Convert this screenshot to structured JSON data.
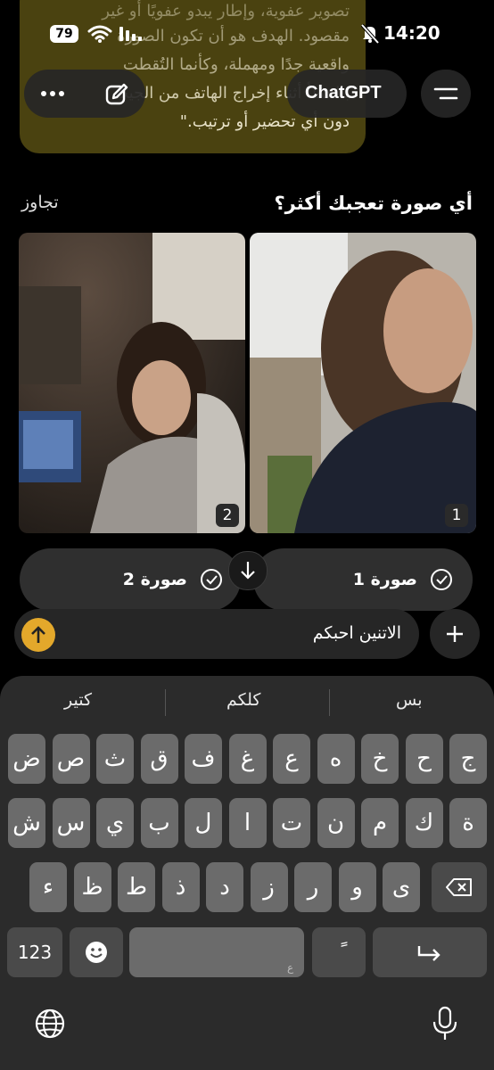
{
  "status_bar": {
    "battery": "79",
    "time": "14:20"
  },
  "bubble": {
    "lines": [
      "تصوير عفوية، وإطار يبدو عفويًا أو غير",
      "مقصود. الهدف هو أن تكون الصورة",
      "واقعية جدًا ومهملة، وكأنما التُقطت",
      "بالخطأ أثناء إخراج الهاتف من الجيب",
      "دون أي تحضير أو ترتيب.\""
    ]
  },
  "header": {
    "title": "ChatGPT"
  },
  "comparison": {
    "question": "أي صورة تعجبك أكثر؟",
    "skip_label": "تجاوز",
    "images": [
      {
        "number": "1"
      },
      {
        "number": "2"
      }
    ],
    "choices": [
      {
        "label": "صورة 1"
      },
      {
        "label": "صورة 2"
      }
    ]
  },
  "composer": {
    "text": "الاتنين احبكم"
  },
  "keyboard": {
    "suggestions": [
      "بس",
      "كلكم",
      "كتير"
    ],
    "row1": [
      "ج",
      "ح",
      "خ",
      "ه",
      "ع",
      "غ",
      "ف",
      "ق",
      "ث",
      "ص",
      "ض"
    ],
    "row2": [
      "ة",
      "ك",
      "م",
      "ن",
      "ت",
      "ا",
      "ل",
      "ب",
      "ي",
      "س",
      "ش"
    ],
    "row3": [
      "ى",
      "و",
      "ر",
      "ز",
      "د",
      "ذ",
      "ط",
      "ظ",
      "ء"
    ],
    "numbers_label": "123",
    "space_hint": "ع",
    "diacritic_label": "ً"
  },
  "colors": {
    "send_button": "#e3a82b",
    "bubble": "#4a4210"
  }
}
